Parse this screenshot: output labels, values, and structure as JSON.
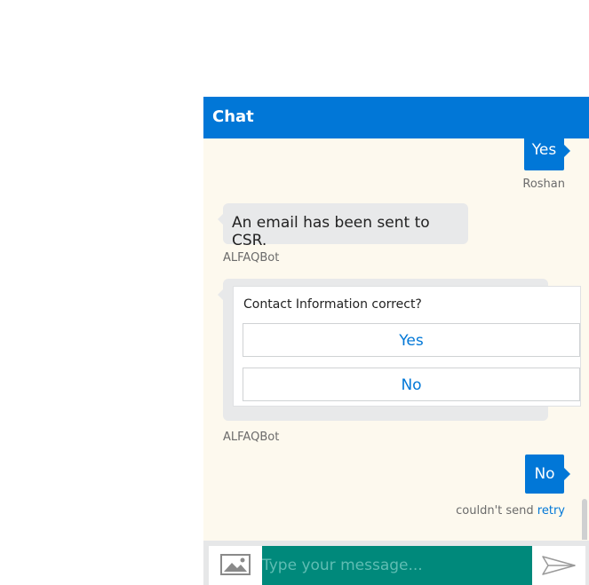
{
  "header": {
    "title": "Chat"
  },
  "messages": [
    {
      "type": "user",
      "text": "Yes",
      "sender": "Roshan"
    },
    {
      "type": "bot",
      "text": "An email has been sent to CSR.",
      "sender": "ALFAQBot"
    },
    {
      "type": "bot-card",
      "title": "Contact Information correct?",
      "options": [
        "Yes",
        "No"
      ],
      "sender": "ALFAQBot"
    },
    {
      "type": "user",
      "text": "No",
      "status": "couldn't send",
      "retry_label": "retry"
    }
  ],
  "composer": {
    "placeholder": "Type your message..."
  },
  "icons": {
    "attach": "image-icon",
    "send": "send-icon"
  },
  "colors": {
    "accent": "#0177d7",
    "background": "#fdf9ee",
    "input": "#00897b"
  }
}
